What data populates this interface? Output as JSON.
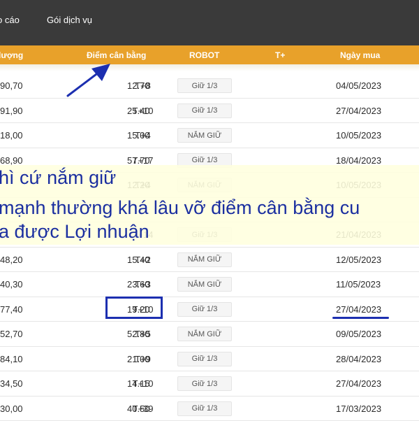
{
  "nav": {
    "items": [
      "o cáo",
      "Gói dịch vụ"
    ]
  },
  "header": {
    "columns": [
      "lượng",
      "Điểm cân bằng",
      "ROBOT",
      "T+",
      "Ngày mua"
    ]
  },
  "rows": [
    {
      "volume": "90,70",
      "balance": "12.70",
      "robot": "Giữ 1/3",
      "tplus": "T+8",
      "date": "04/05/2023"
    },
    {
      "volume": "91,90",
      "balance": "25.40",
      "robot": "Giữ 1/3",
      "tplus": "T+10",
      "date": "27/04/2023"
    },
    {
      "volume": "18,00",
      "balance": "15.00",
      "robot": "NẮM GIỮ",
      "tplus": "T+4",
      "date": "10/05/2023"
    },
    {
      "volume": "68,90",
      "balance": "57.70",
      "robot": "Giữ 1/3",
      "tplus": "T+17",
      "date": "18/04/2023"
    },
    {
      "volume": "",
      "balance": "12.20",
      "robot": "NẮM GIỮ",
      "tplus": "T+4",
      "date": "10/05/2023"
    },
    {
      "volume": "",
      "balance": "",
      "robot": "",
      "tplus": "",
      "date": ""
    },
    {
      "volume": "",
      "balance": "",
      "robot": "Giữ 1/3",
      "tplus": "T+14",
      "date": "21/04/2023"
    },
    {
      "volume": "48,20",
      "balance": "15.40",
      "robot": "NẮM GIỮ",
      "tplus": "T+2",
      "date": "12/05/2023"
    },
    {
      "volume": "40,30",
      "balance": "23.60",
      "robot": "NẮM GIỮ",
      "tplus": "T+3",
      "date": "11/05/2023"
    },
    {
      "volume": "77,40",
      "balance": "19.20",
      "robot": "Giữ 1/3",
      "tplus": "T+10",
      "date": "27/04/2023"
    },
    {
      "volume": "52,70",
      "balance": "52.80",
      "robot": "NẮM GIỮ",
      "tplus": "T+5",
      "date": "09/05/2023"
    },
    {
      "volume": "84,10",
      "balance": "21.00",
      "robot": "Giữ 1/3",
      "tplus": "T+9",
      "date": "28/04/2023"
    },
    {
      "volume": "34,50",
      "balance": "14.15",
      "robot": "Giữ 1/3",
      "tplus": "T+10",
      "date": "27/04/2023"
    },
    {
      "volume": "30,00",
      "balance": "40.50",
      "robot": "Giữ 1/3",
      "tplus": "T+39",
      "date": "17/03/2023"
    }
  ],
  "banner": {
    "lines": [
      "hì cứ nắm giữ",
      "mạnh thường khá lâu vỡ điểm cân bằng cu",
      "a được Lợi nhuận"
    ]
  },
  "annotation_color": "#1c2fb0",
  "accent_color": "#e8a12a"
}
